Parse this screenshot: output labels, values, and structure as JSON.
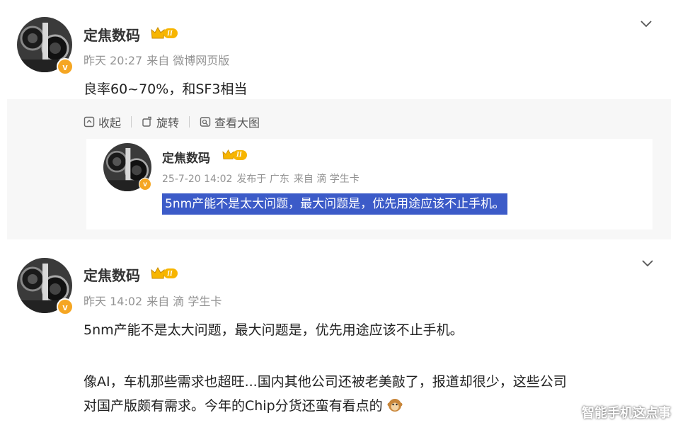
{
  "post1": {
    "author": "定焦数码",
    "level": "II",
    "badge": "v",
    "time": "昨天 20:27",
    "source": "来自 微博网页版",
    "text": "良率60~70%，和SF3相当",
    "toolbar": {
      "collapse_label": "收起",
      "rotate_label": "旋转",
      "view_large_label": "查看大图"
    },
    "quoted": {
      "author": "定焦数码",
      "level": "II",
      "badge": "v",
      "time": "25-7-20 14:02",
      "location": "发布于 广东",
      "source": "来自 滴 学生卡",
      "text": "5nm产能不是太大问题，最大问题是，优先用途应该不止手机。"
    }
  },
  "post2": {
    "author": "定焦数码",
    "level": "II",
    "badge": "v",
    "time": "昨天 14:02",
    "source": "来自 滴 学生卡",
    "text_line1": "5nm产能不是太大问题，最大问题是，优先用途应该不止手机。",
    "text_line2": "像AI，车机那些需求也超旺...国内其他公司还被老美敲了，报道却很少，这些公司",
    "text_line3": "对国产版颇有需求。今年的Chip分货还蛮有看点的"
  },
  "watermark": "智能手机这点事",
  "colors": {
    "highlight": "#3c5bc8",
    "crown": "#f7b500",
    "vbadge": "#f5a623"
  }
}
